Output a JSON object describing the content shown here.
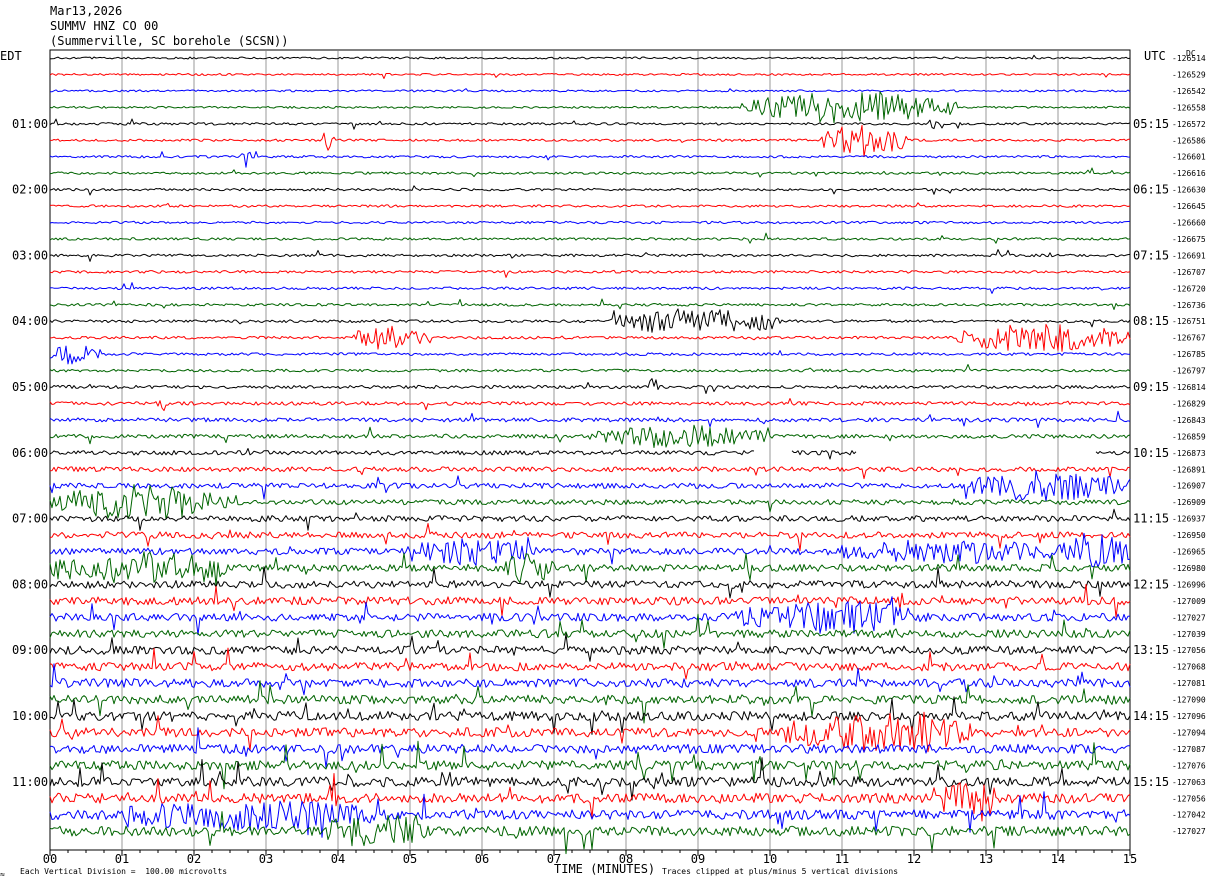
{
  "header": {
    "date": "Mar13,2026",
    "station": "SUMMV HNZ CO 00",
    "location": "(Summerville, SC borehole (SCSN))"
  },
  "left_timezone": "EDT",
  "right_timezone": "UTC",
  "dc_label": "DC",
  "footer": {
    "scale_note": "Each Vertical Division =  100.00 microvolts",
    "xlabel": "TIME (MINUTES)",
    "clip_note": "Traces clipped at plus/minus 5 vertical divisions"
  },
  "colors": {
    "trace_cycle": [
      "#000000",
      "#ff0000",
      "#0000ff",
      "#006400"
    ],
    "grid": "#808080"
  },
  "chart_data": {
    "type": "line",
    "title": "SUMMV HNZ CO 00",
    "xlabel": "TIME (MINUTES)",
    "x_ticks": [
      "00",
      "01",
      "02",
      "03",
      "04",
      "05",
      "06",
      "07",
      "08",
      "09",
      "10",
      "11",
      "12",
      "13",
      "14",
      "15"
    ],
    "xlim": [
      0,
      15
    ],
    "grid": true,
    "left_hour_labels": [
      "01:00",
      "02:00",
      "03:00",
      "04:00",
      "05:00",
      "06:00",
      "07:00",
      "08:00",
      "09:00",
      "10:00",
      "11:00"
    ],
    "right_hour_labels": [
      "05:15",
      "06:15",
      "07:15",
      "08:15",
      "09:15",
      "10:15",
      "11:15",
      "12:15",
      "13:15",
      "14:15",
      "15:15"
    ],
    "trace_dc_offsets": [
      -126514,
      -126529,
      -126542,
      -126558,
      -126572,
      -126586,
      -126601,
      -126616,
      -126630,
      -126645,
      -126660,
      -126675,
      -126691,
      -126707,
      -126720,
      -126736,
      -126751,
      -126767,
      -126785,
      -126797,
      -126814,
      -126829,
      -126843,
      -126859,
      -126873,
      -126891,
      -126907,
      -126909,
      -126937,
      -126950,
      -126965,
      -126980,
      -126996,
      -127009,
      -127027,
      -127039,
      -127056,
      -127068,
      -127081,
      -127090,
      -127096,
      -127094,
      -127087,
      -127076,
      -127063,
      -127056,
      -127042,
      -127027
    ],
    "trace_noise_level": [
      1,
      1,
      1,
      1,
      1.2,
      1.2,
      1.2,
      1.2,
      1.2,
      1.2,
      1.2,
      1.2,
      1.3,
      1.3,
      1.3,
      1.3,
      1.4,
      1.4,
      1.4,
      1.4,
      1.6,
      1.8,
      2,
      2,
      2.2,
      2.4,
      2.6,
      2.6,
      3,
      3.2,
      3.4,
      3.6,
      3.8,
      4,
      4,
      4,
      4.2,
      4.2,
      4.4,
      4.4,
      4.6,
      4.6,
      4.6,
      4.8,
      5,
      5,
      5,
      5
    ],
    "events": [
      {
        "trace": 3,
        "start_min": 9.6,
        "end_min": 12.6,
        "amplitude": 3.5
      },
      {
        "trace": 4,
        "start_min": 12.2,
        "end_min": 12.4,
        "amplitude": 1.5
      },
      {
        "trace": 5,
        "start_min": 3.8,
        "end_min": 3.95,
        "amplitude": 2.2
      },
      {
        "trace": 5,
        "start_min": 10.7,
        "end_min": 11.9,
        "amplitude": 3.5
      },
      {
        "trace": 6,
        "start_min": 2.65,
        "end_min": 2.8,
        "amplitude": 2.6
      },
      {
        "trace": 16,
        "start_min": 7.8,
        "end_min": 10.2,
        "amplitude": 2.8
      },
      {
        "trace": 17,
        "start_min": 4.2,
        "end_min": 5.3,
        "amplitude": 2.5
      },
      {
        "trace": 17,
        "start_min": 12.6,
        "end_min": 15.0,
        "amplitude": 3.0
      },
      {
        "trace": 18,
        "start_min": 0.0,
        "end_min": 0.7,
        "amplitude": 2.2
      },
      {
        "trace": 20,
        "start_min": 8.3,
        "end_min": 8.45,
        "amplitude": 1.8
      },
      {
        "trace": 21,
        "start_min": 1.5,
        "end_min": 1.6,
        "amplitude": 2.2
      },
      {
        "trace": 23,
        "start_min": 7.5,
        "end_min": 9.9,
        "amplitude": 2.2
      },
      {
        "trace": 26,
        "start_min": 12.8,
        "end_min": 15.0,
        "amplitude": 3.0
      },
      {
        "trace": 27,
        "start_min": 0.0,
        "end_min": 2.5,
        "amplitude": 3.5
      },
      {
        "trace": 30,
        "start_min": 5.0,
        "end_min": 6.8,
        "amplitude": 2.4
      },
      {
        "trace": 30,
        "start_min": 11.0,
        "end_min": 14.0,
        "amplitude": 2.0
      },
      {
        "trace": 30,
        "start_min": 14.0,
        "end_min": 15.0,
        "amplitude": 3.5
      },
      {
        "trace": 31,
        "start_min": 0.0,
        "end_min": 2.5,
        "amplitude": 3.0
      },
      {
        "trace": 31,
        "start_min": 6.3,
        "end_min": 7.0,
        "amplitude": 2.8
      },
      {
        "trace": 34,
        "start_min": 9.5,
        "end_min": 12.2,
        "amplitude": 2.8
      },
      {
        "trace": 41,
        "start_min": 10.2,
        "end_min": 12.8,
        "amplitude": 3.5
      },
      {
        "trace": 45,
        "start_min": 12.2,
        "end_min": 13.2,
        "amplitude": 2.5
      },
      {
        "trace": 46,
        "start_min": 1.0,
        "end_min": 4.5,
        "amplitude": 2.5
      },
      {
        "trace": 47,
        "start_min": 3.8,
        "end_min": 5.2,
        "amplitude": 2.8
      }
    ],
    "gaps": [
      {
        "trace": 24,
        "start_min": 9.8,
        "end_min": 10.3
      },
      {
        "trace": 24,
        "start_min": 11.2,
        "end_min": 14.5
      }
    ]
  }
}
